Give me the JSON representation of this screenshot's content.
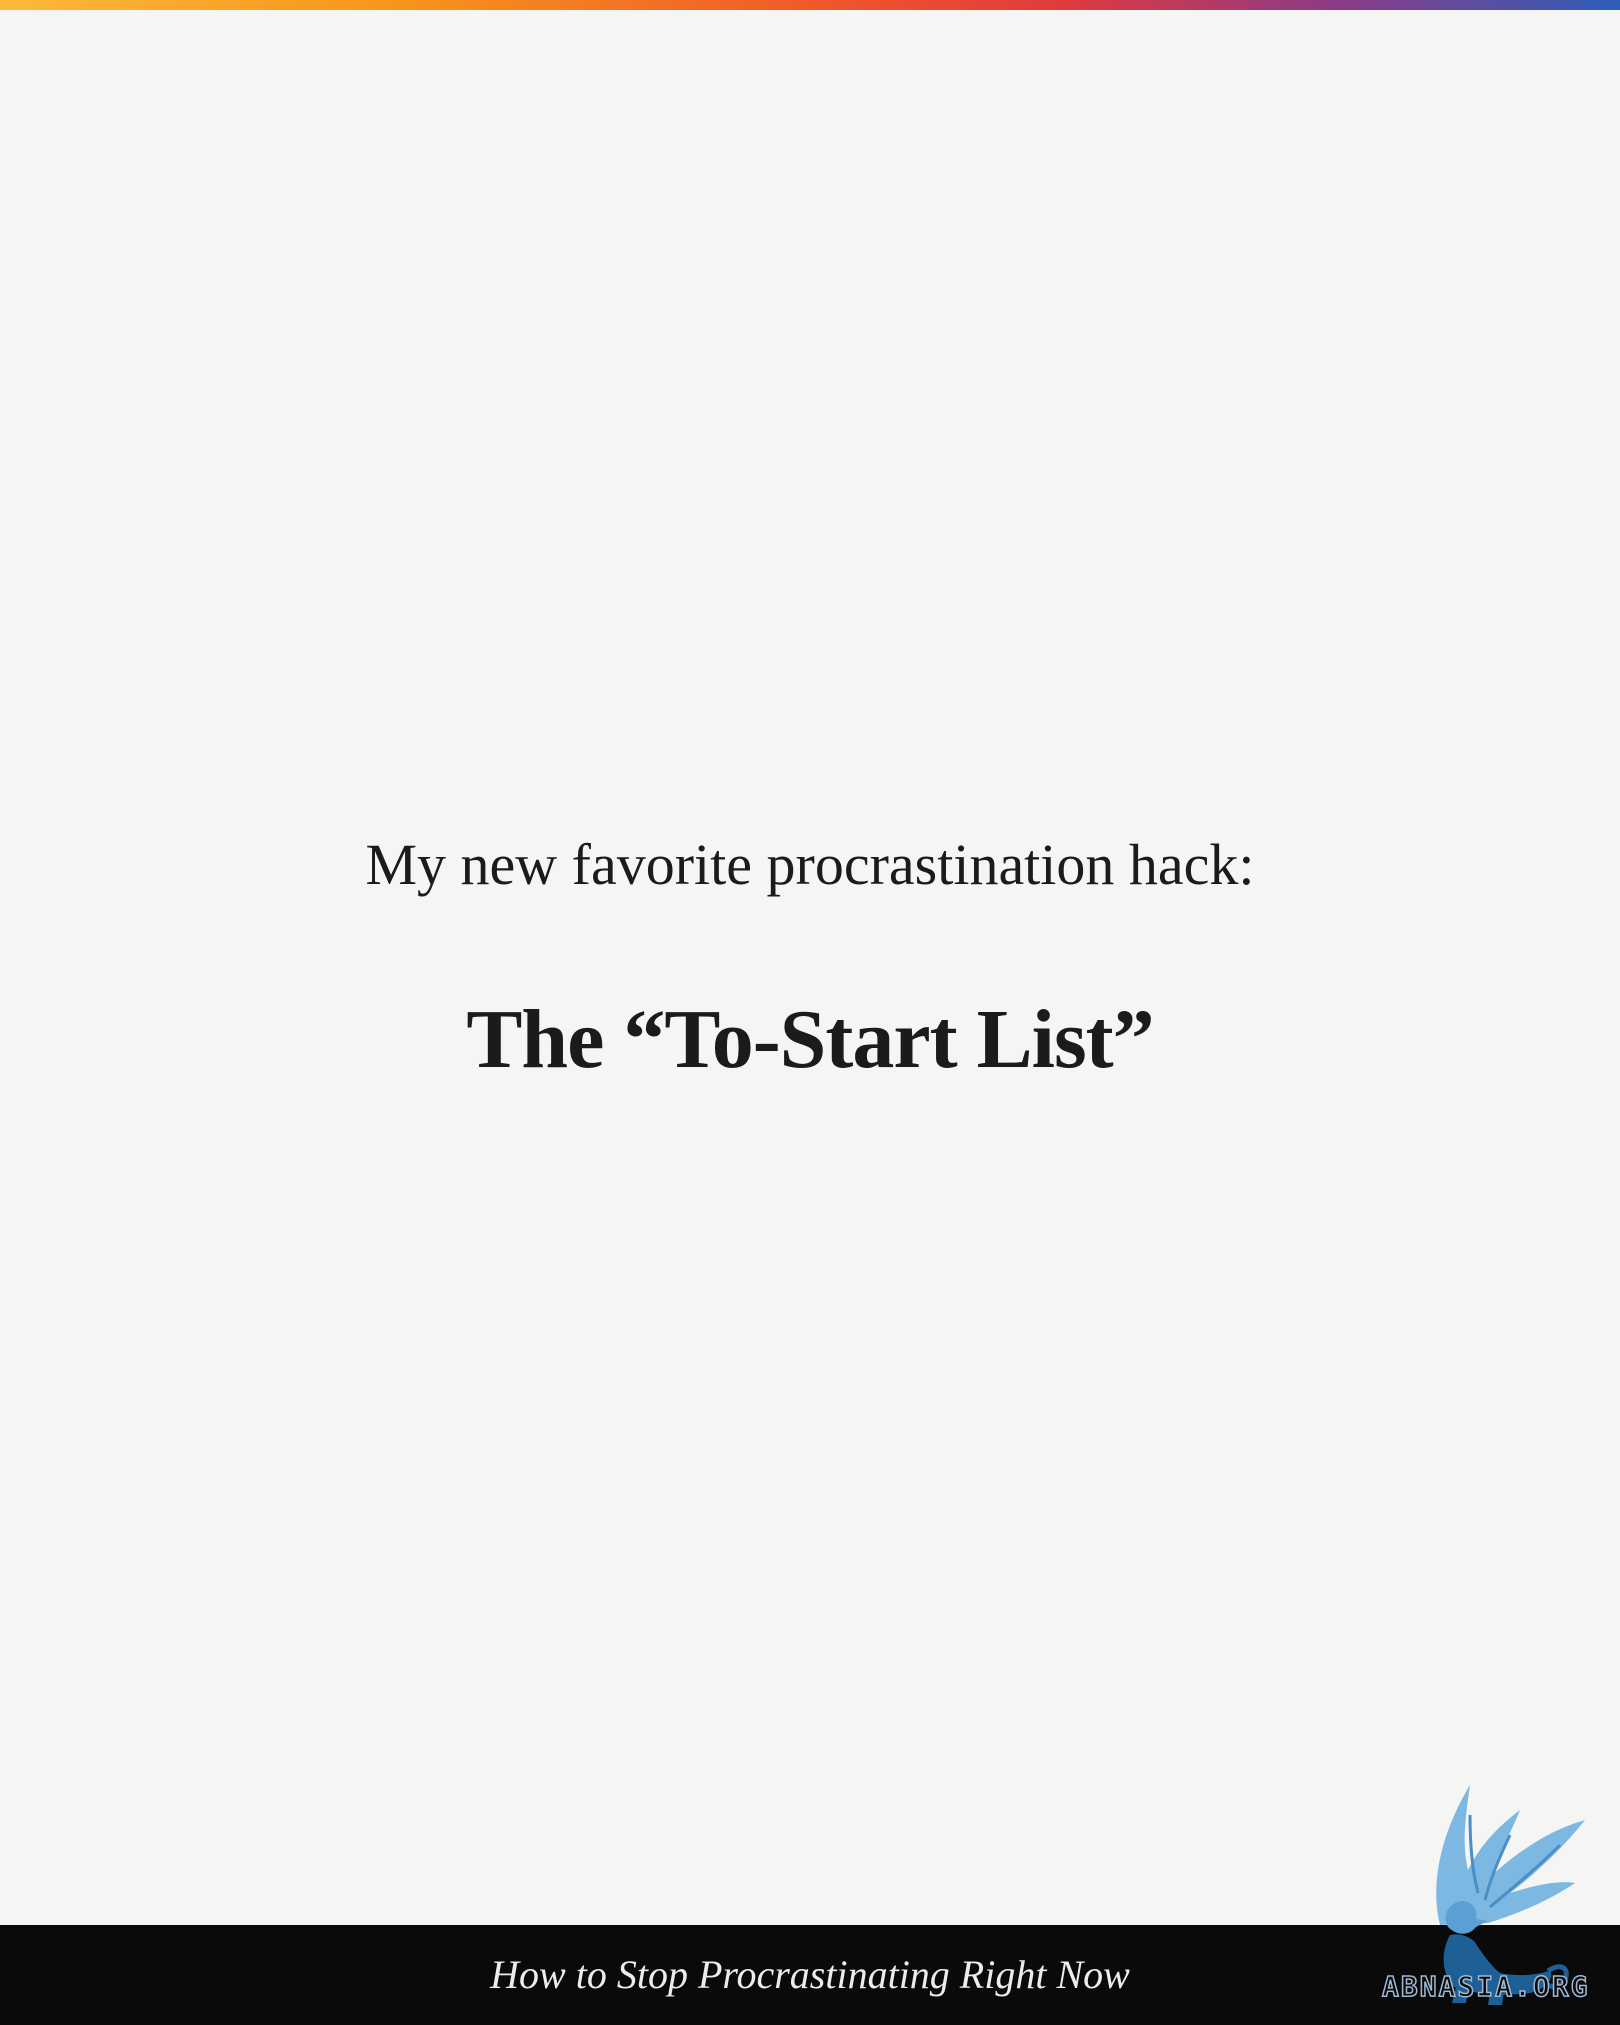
{
  "slide": {
    "intro": "My new favorite procrastination hack:",
    "headline": "The “To-Start List”"
  },
  "footer": {
    "title": "How to Stop Procrastinating Right Now"
  },
  "watermark": {
    "text": "ABNASIA.ORG",
    "icon": "winged-griffin-logo"
  },
  "colors": {
    "background": "#f5f5f4",
    "text": "#1b1b1b",
    "footer_bg": "#0a0a0a",
    "footer_text": "#ececec",
    "accent_gradient": [
      "#fcb93a",
      "#f7941d",
      "#ef5a2a",
      "#e23b3b",
      "#8e3b86",
      "#2d5fb8"
    ],
    "logo": "#6fb1e0"
  }
}
